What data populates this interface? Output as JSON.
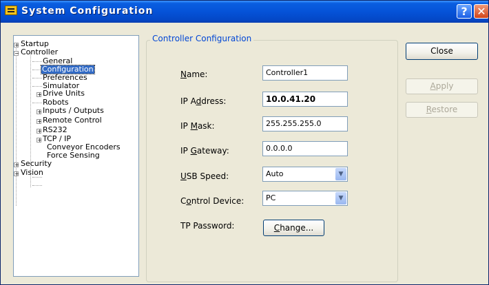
{
  "window": {
    "title": "System Configuration"
  },
  "tree": {
    "startup": "Startup",
    "controller": "Controller",
    "general": "General",
    "configuration": "Configuration",
    "preferences": "Preferences",
    "simulator": "Simulator",
    "drive_units": "Drive Units",
    "robots": "Robots",
    "inputs_outputs": "Inputs / Outputs",
    "remote_control": "Remote Control",
    "rs232": "RS232",
    "tcp_ip": "TCP / IP",
    "conveyor_encoders": "Conveyor Encoders",
    "force_sensing": "Force Sensing",
    "security": "Security",
    "vision": "Vision",
    "expand_plus": "+",
    "collapse_minus": "−"
  },
  "group": {
    "legend": "Controller Configuration"
  },
  "fields": {
    "name_label_u": "N",
    "name_label_rest": "ame:",
    "name_value": "Controller1",
    "ip_label_pre": "IP A",
    "ip_label_u": "d",
    "ip_label_rest": "dress:",
    "ip_value": "10.0.41.20",
    "mask_label_pre": "IP ",
    "mask_label_u": "M",
    "mask_label_rest": "ask:",
    "mask_value": "255.255.255.0",
    "gw_label_pre": "IP ",
    "gw_label_u": "G",
    "gw_label_rest": "ateway:",
    "gw_value": "0.0.0.0",
    "usb_label_u": "U",
    "usb_label_rest": "SB Speed:",
    "usb_value": "Auto",
    "cd_label_pre": "C",
    "cd_label_u": "o",
    "cd_label_rest": "ntrol Device:",
    "cd_value": "PC",
    "tp_label": "TP Password:",
    "change_u": "C",
    "change_rest": "hange..."
  },
  "buttons": {
    "close": "Close",
    "apply_u": "A",
    "apply_rest": "pply",
    "restore_u": "R",
    "restore_rest": "estore"
  },
  "icons": {
    "help": "?",
    "close": "✕",
    "dropdown": "▼"
  }
}
